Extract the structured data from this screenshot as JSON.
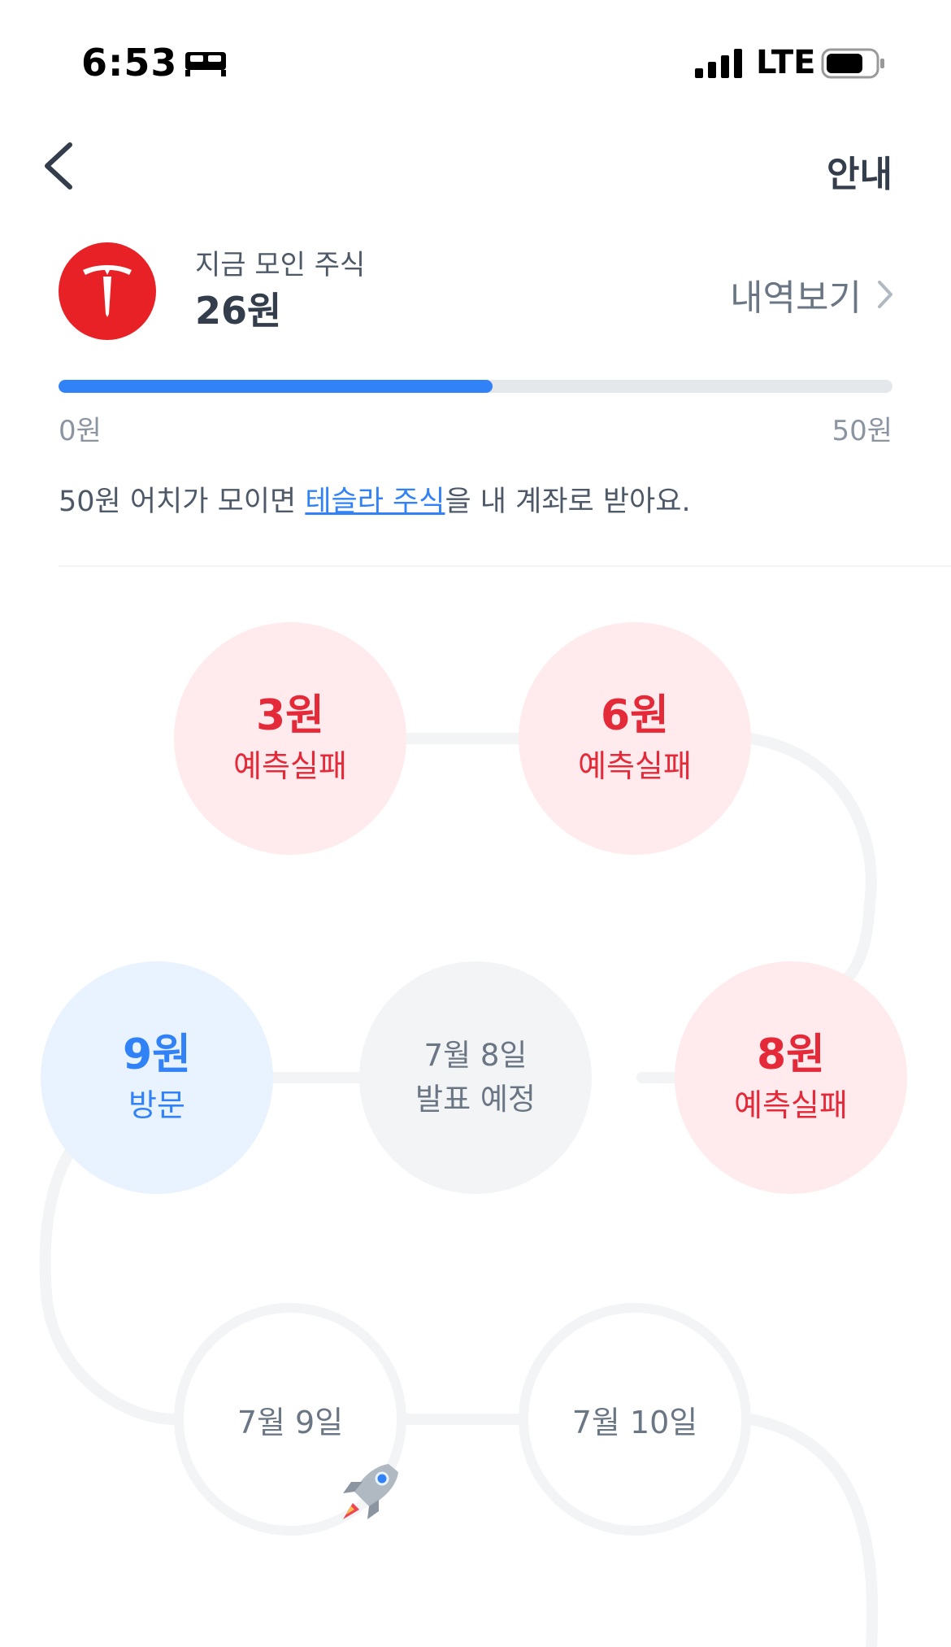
{
  "status_bar": {
    "time": "6:53",
    "network": "LTE",
    "icons": [
      "bed-icon",
      "signal-icon",
      "battery-icon"
    ]
  },
  "nav": {
    "back_icon": "chevron-left-icon",
    "guide_label": "안내"
  },
  "summary": {
    "logo": "tesla-logo",
    "label": "지금 모인 주식",
    "amount": "26원",
    "history_label": "내역보기"
  },
  "progress": {
    "min_label": "0원",
    "max_label": "50원",
    "fraction": 0.52
  },
  "info": {
    "before": "50원 어치가 모이면 ",
    "link": "테슬라 주식",
    "after": "을 내 계좌로 받아요."
  },
  "nodes": [
    {
      "state": "fail",
      "amount": "3원",
      "status": "예측실패"
    },
    {
      "state": "fail",
      "amount": "6원",
      "status": "예측실패"
    },
    {
      "state": "fail",
      "amount": "8원",
      "status": "예측실패"
    },
    {
      "state": "pending",
      "date": "7월 8일",
      "status": "발표 예정"
    },
    {
      "state": "visit",
      "amount": "9원",
      "status": "방문"
    },
    {
      "state": "future",
      "date": "7월 9일"
    },
    {
      "state": "future",
      "date": "7월 10일"
    }
  ],
  "colors": {
    "accent": "#3182f6",
    "fail": "#e42939",
    "fail_bg": "#ffebed",
    "tesla_red": "#e82127"
  }
}
